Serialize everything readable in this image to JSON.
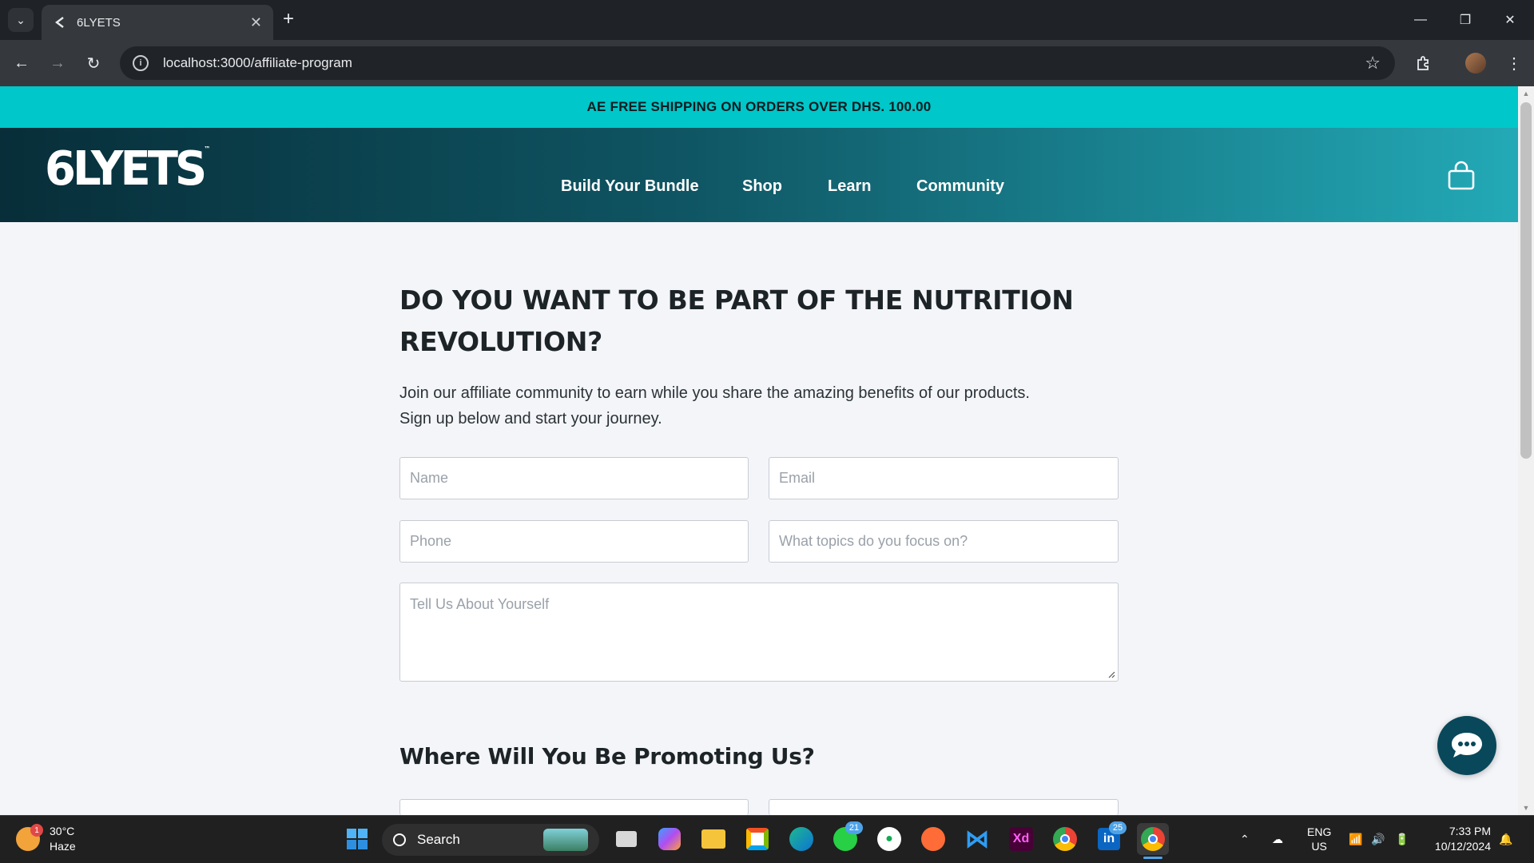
{
  "browser": {
    "tab_title": "6LYETS",
    "tab_close": "✕",
    "new_tab": "+",
    "url": "localhost:3000/affiliate-program",
    "window_controls": [
      "—",
      "❐",
      "✕"
    ]
  },
  "page": {
    "shipping_banner": "AE FREE SHIPPING ON ORDERS OVER DHS. 100.00",
    "logo_text": "6LYETS",
    "nav": [
      "Build Your Bundle",
      "Shop",
      "Learn",
      "Community"
    ],
    "headline_line1": "DO YOU WANT TO BE PART OF THE NUTRITION",
    "headline_line2": "REVOLUTION?",
    "lead_line1": "Join our affiliate community to earn while you share the amazing benefits of our products.",
    "lead_line2": "Sign up below and start your journey.",
    "form": {
      "name_placeholder": "Name",
      "email_placeholder": "Email",
      "phone_placeholder": "Phone",
      "topics_placeholder": "What topics do you focus on?",
      "about_placeholder": "Tell Us About Yourself"
    },
    "promote_heading": "Where Will You Be Promoting Us?"
  },
  "taskbar": {
    "weather_temp": "30°C",
    "weather_desc": "Haze",
    "weather_badge": "1",
    "search_label": "Search",
    "whatsapp_badge": "21",
    "linkedin_badge": "25",
    "lang_line1": "ENG",
    "lang_line2": "US",
    "time": "7:33 PM",
    "date": "10/12/2024"
  },
  "colors": {
    "shipping_bar": "#00c7c9",
    "header_start": "#072e39",
    "header_end": "#23a9b6",
    "chat_button": "#08485a"
  }
}
